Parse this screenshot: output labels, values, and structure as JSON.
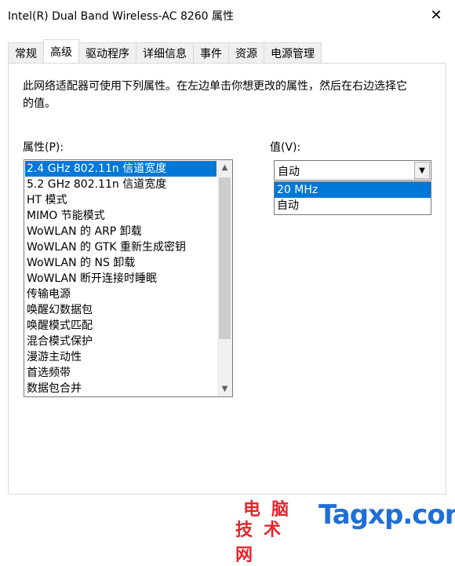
{
  "window": {
    "title": "Intel(R) Dual Band Wireless-AC 8260 属性",
    "close_glyph": "✕"
  },
  "tabs": [
    {
      "label": "常规",
      "active": false
    },
    {
      "label": "高级",
      "active": true
    },
    {
      "label": "驱动程序",
      "active": false
    },
    {
      "label": "详细信息",
      "active": false
    },
    {
      "label": "事件",
      "active": false
    },
    {
      "label": "资源",
      "active": false
    },
    {
      "label": "电源管理",
      "active": false
    }
  ],
  "advanced": {
    "description": "此网络适配器可使用下列属性。在左边单击你想更改的属性，然后在右边选择它的值。",
    "property_label": "属性(P):",
    "value_label": "值(V):",
    "properties": [
      "2.4 GHz 802.11n 信道宽度",
      "5.2 GHz 802.11n 信道宽度",
      "HT 模式",
      "MIMO 节能模式",
      "WoWLAN 的 ARP 卸载",
      "WoWLAN 的 GTK 重新生成密钥",
      "WoWLAN 的 NS 卸载",
      "WoWLAN 断开连接时睡眠",
      "传输电源",
      "唤醒幻数据包",
      "唤醒模式匹配",
      "混合模式保护",
      "漫游主动性",
      "首选频带",
      "数据包合并"
    ],
    "selected_property_index": 0,
    "value_selected": "自动",
    "value_options": [
      "20 MHz",
      "自动"
    ],
    "highlighted_option_index": 0
  },
  "watermark": {
    "cn_line1": "电脑",
    "cn_line2": "技术网",
    "en": "Tagxp.com"
  },
  "colors": {
    "selection": "#0078d7",
    "watermark_red": "#e4252c",
    "watermark_blue": "#1f6fd6"
  }
}
